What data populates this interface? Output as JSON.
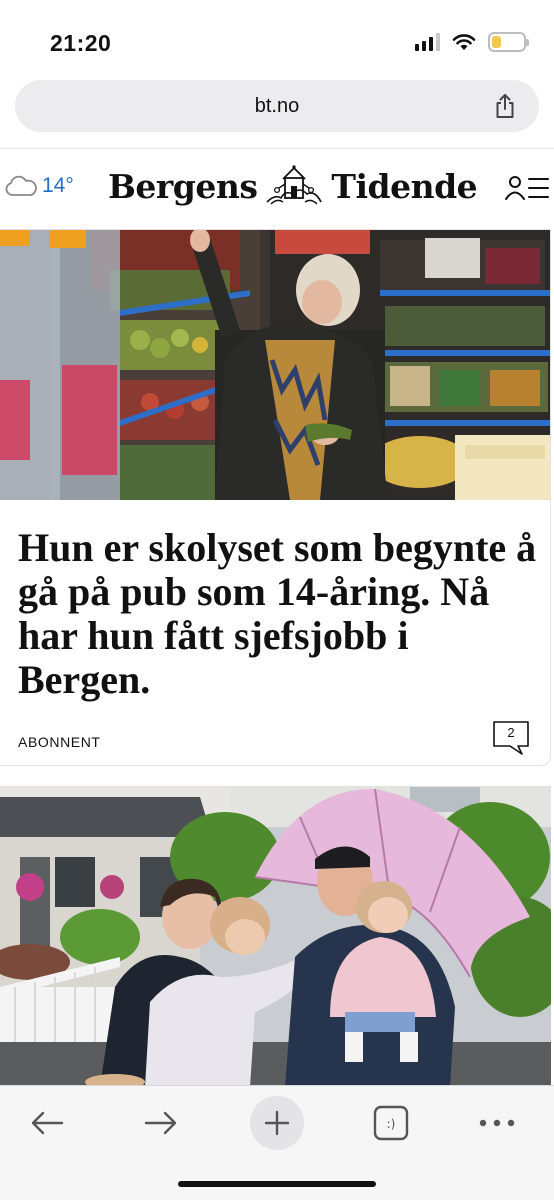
{
  "status_bar": {
    "time": "21:20",
    "signal_icon": "cellular-signal-icon",
    "wifi_icon": "wifi-icon",
    "battery_icon": "battery-icon",
    "battery_level": 0.3,
    "battery_color": "#f2c94c"
  },
  "browser": {
    "url": "bt.no",
    "share_icon": "share-icon"
  },
  "site_header": {
    "weather_icon": "cloud-icon",
    "temperature": "14°",
    "temperature_color": "#1f6fd1",
    "logo_left": "Bergens",
    "logo_right": "Tidende",
    "logo_emblem": "city-crest-icon",
    "menu_icon": "user-menu-icon"
  },
  "articles": [
    {
      "headline": "Hun er skolyset som begynte å gå på pub som 14-åring. Nå har hun fått sjefsjobb i Bergen.",
      "badge": "ABONNENT",
      "comment_count": "2",
      "image": "woman-in-grocery-store-photo"
    },
    {
      "image": "family-with-umbrella-photo"
    }
  ],
  "toolbar": {
    "back_icon": "arrow-left-icon",
    "forward_icon": "arrow-right-icon",
    "new_tab_icon": "plus-icon",
    "tabs_icon": "tabs-icon",
    "tabs_label": ":)",
    "more_icon": "more-dots-icon"
  }
}
